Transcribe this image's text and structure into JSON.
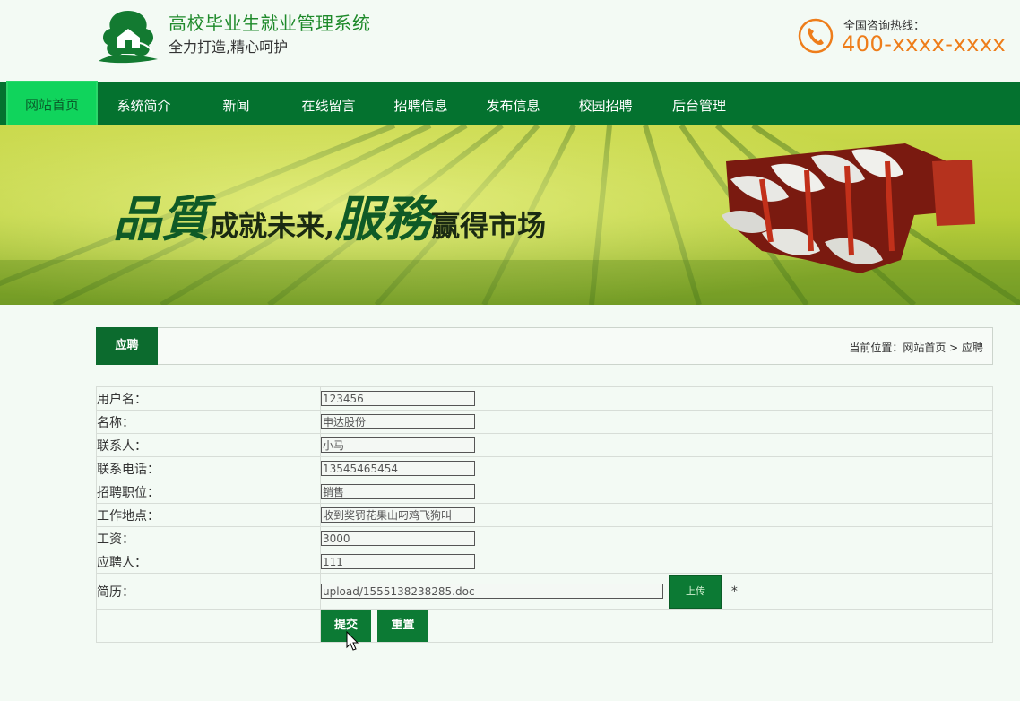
{
  "header": {
    "title": "高校毕业生就业管理系统",
    "slogan": "全力打造,精心呵护",
    "hotline_label": "全国咨询热线：",
    "hotline_number": "400-xxxx-xxxx"
  },
  "nav": [
    {
      "label": "网站首页",
      "active": true
    },
    {
      "label": "系统简介"
    },
    {
      "label": "新闻"
    },
    {
      "label": "在线留言"
    },
    {
      "label": "招聘信息"
    },
    {
      "label": "发布信息"
    },
    {
      "label": "校园招聘"
    },
    {
      "label": "后台管理"
    }
  ],
  "banner": {
    "slogan_part1": "品質",
    "slogan_part2": "成就未来,",
    "slogan_part3": "服務",
    "slogan_part4": "赢得市场"
  },
  "panel": {
    "tab_label": "应聘",
    "breadcrumb": "当前位置：网站首页 > 应聘"
  },
  "form": {
    "fields": [
      {
        "label": "用户名：",
        "value": "123456"
      },
      {
        "label": "名称：",
        "value": "申达股份"
      },
      {
        "label": "联系人：",
        "value": "小马"
      },
      {
        "label": "联系电话：",
        "value": "13545465454"
      },
      {
        "label": "招聘职位：",
        "value": "销售"
      },
      {
        "label": "工作地点：",
        "value": "收到奖罚花果山叼鸡飞狗叫"
      },
      {
        "label": "工资：",
        "value": "3000"
      },
      {
        "label": "应聘人：",
        "value": "111"
      }
    ],
    "resume_label": "简历：",
    "resume_value": "upload/1555138238285.doc",
    "upload_label": "上传",
    "required_mark": "*",
    "submit_label": "提交",
    "reset_label": "重置"
  },
  "colors": {
    "nav_bg": "#04722f",
    "nav_active": "#10d45c",
    "accent": "#0c7a34",
    "hotline": "#ee7d1a"
  }
}
